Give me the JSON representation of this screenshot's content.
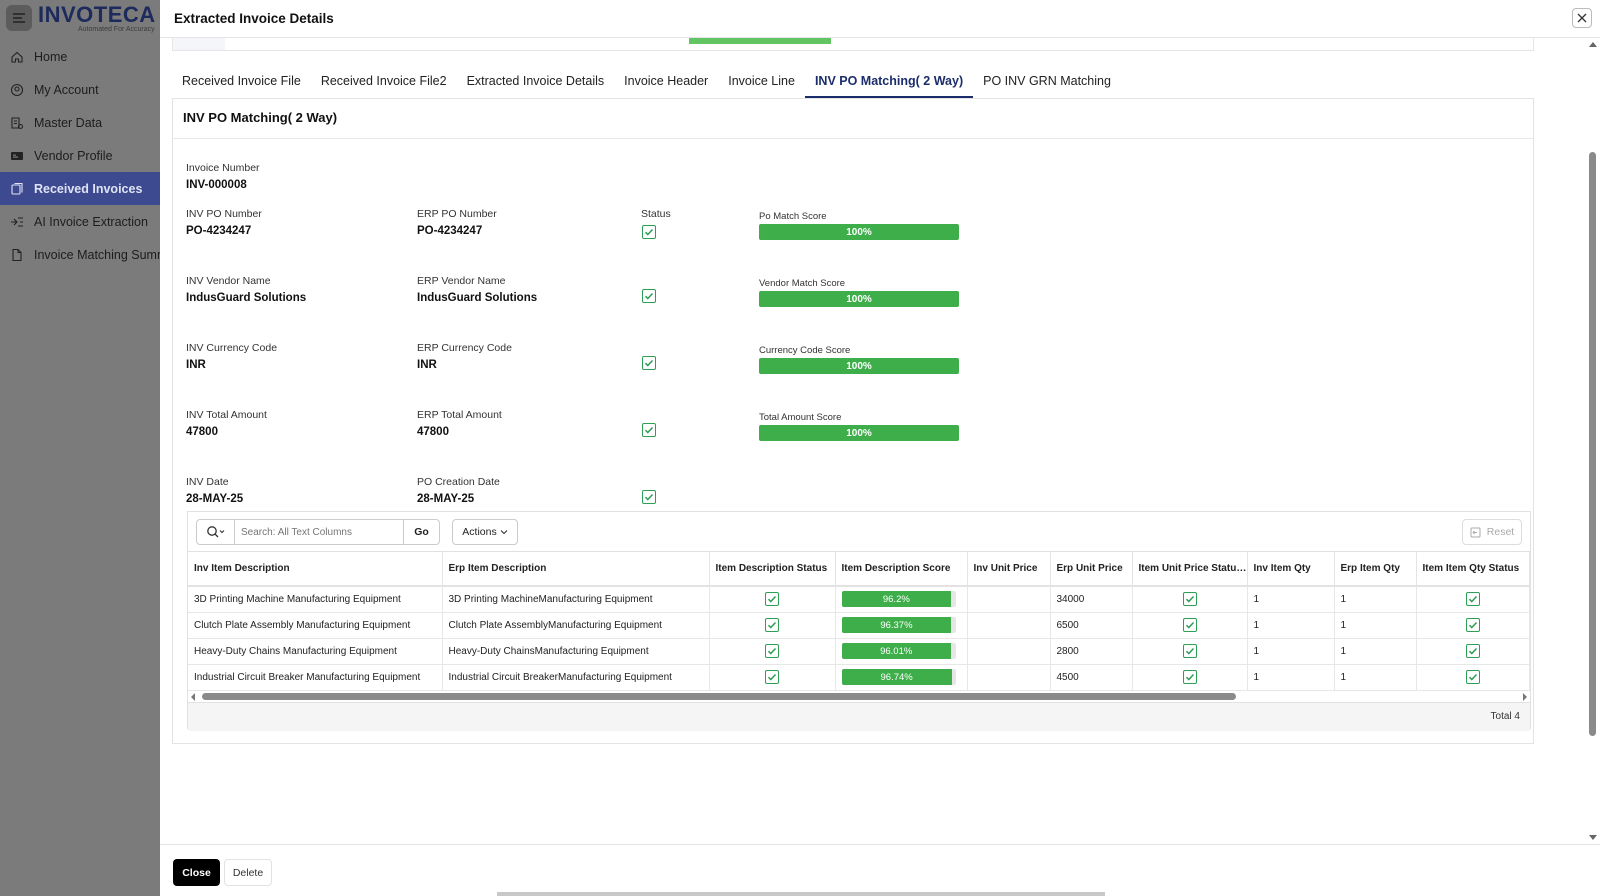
{
  "app": {
    "logo_main": "INVOTECA",
    "logo_sub": "Automated For Accuracy"
  },
  "sidebar": {
    "items": [
      {
        "label": "Home",
        "icon": "home-icon"
      },
      {
        "label": "My Account",
        "icon": "user-circle-icon"
      },
      {
        "label": "Master Data",
        "icon": "database-icon"
      },
      {
        "label": "Vendor Profile",
        "icon": "id-card-icon"
      },
      {
        "label": "Received Invoices",
        "icon": "documents-icon",
        "active": true
      },
      {
        "label": "AI Invoice Extraction",
        "icon": "ai-extract-icon"
      },
      {
        "label": "Invoice Matching Summa",
        "icon": "file-icon"
      }
    ]
  },
  "modal": {
    "title": "Extracted Invoice Details",
    "tabs": [
      "Received Invoice File",
      "Received Invoice File2",
      "Extracted Invoice Details",
      "Invoice Header",
      "Invoice Line",
      "INV PO Matching( 2 Way)",
      "PO INV GRN Matching"
    ],
    "active_tab": 5,
    "panel_title": "INV PO Matching( 2 Way)",
    "invoice_number": {
      "label": "Invoice Number",
      "value": "INV-000008"
    },
    "status_label": "Status",
    "rows": [
      {
        "inv_label": "INV PO Number",
        "inv_value": "PO-4234247",
        "erp_label": "ERP PO Number",
        "erp_value": "PO-4234247",
        "score_label": "Po Match Score",
        "score": "100%",
        "score_pct": 100
      },
      {
        "inv_label": "INV Vendor Name",
        "inv_value": "IndusGuard Solutions",
        "erp_label": "ERP Vendor Name",
        "erp_value": "IndusGuard Solutions",
        "score_label": "Vendor Match Score",
        "score": "100%",
        "score_pct": 100
      },
      {
        "inv_label": "INV Currency Code",
        "inv_value": "INR",
        "erp_label": "ERP Currency Code",
        "erp_value": "INR",
        "score_label": "Currency Code Score",
        "score": "100%",
        "score_pct": 100
      },
      {
        "inv_label": "INV Total Amount",
        "inv_value": "47800",
        "erp_label": "ERP Total Amount",
        "erp_value": "47800",
        "score_label": "Total Amount Score",
        "score": "100%",
        "score_pct": 100
      },
      {
        "inv_label": "INV Date",
        "inv_value": "28-MAY-25",
        "erp_label": "PO Creation Date",
        "erp_value": "28-MAY-25"
      }
    ],
    "grid": {
      "search_placeholder": "Search: All Text Columns",
      "go_label": "Go",
      "actions_label": "Actions",
      "reset_label": "Reset",
      "columns": [
        "Inv Item Description",
        "Erp Item Description",
        "Item Description Status",
        "Item Description Score",
        "Inv Unit Price",
        "Erp Unit Price",
        "Item Unit Price Status..",
        "Inv Item Qty",
        "Erp Item Qty",
        "Item Item Qty Status"
      ],
      "rows": [
        {
          "inv_desc": "3D Printing Machine Manufacturing Equipment",
          "erp_desc": "3D Printing MachineManufacturing Equipment",
          "score": "96.2%",
          "score_pct": 96.2,
          "inv_price": "",
          "erp_price": "34000",
          "inv_qty": "1",
          "erp_qty": "1"
        },
        {
          "inv_desc": "Clutch Plate Assembly Manufacturing Equipment",
          "erp_desc": "Clutch Plate AssemblyManufacturing Equipment",
          "score": "96.37%",
          "score_pct": 96.37,
          "inv_price": "",
          "erp_price": "6500",
          "inv_qty": "1",
          "erp_qty": "1"
        },
        {
          "inv_desc": "Heavy-Duty Chains Manufacturing Equipment",
          "erp_desc": "Heavy-Duty ChainsManufacturing Equipment",
          "score": "96.01%",
          "score_pct": 96.01,
          "inv_price": "",
          "erp_price": "2800",
          "inv_qty": "1",
          "erp_qty": "1"
        },
        {
          "inv_desc": "Industrial Circuit Breaker Manufacturing Equipment",
          "erp_desc": "Industrial Circuit BreakerManufacturing Equipment",
          "score": "96.74%",
          "score_pct": 96.74,
          "inv_price": "",
          "erp_price": "4500",
          "inv_qty": "1",
          "erp_qty": "1"
        }
      ],
      "total_label": "Total 4"
    },
    "footer": {
      "close_label": "Close",
      "delete_label": "Delete"
    }
  },
  "colors": {
    "accent": "#3d4a8f",
    "success": "#3dae49",
    "tab_active": "#1b2d6b"
  }
}
